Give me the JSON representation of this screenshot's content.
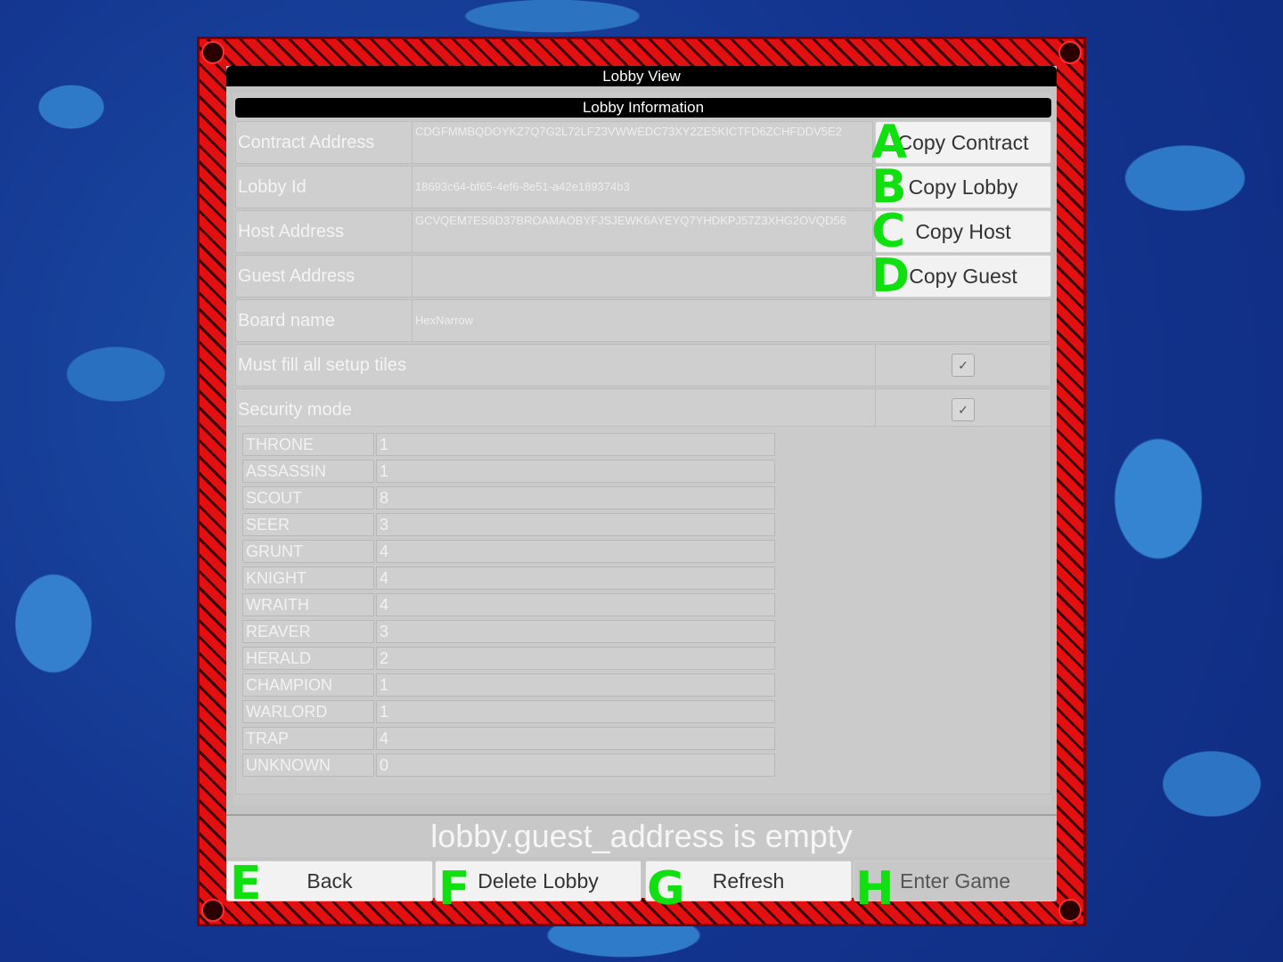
{
  "window": {
    "title": "Lobby View"
  },
  "panel": {
    "title": "Lobby Information"
  },
  "fields": {
    "contract": {
      "label": "Contract Address",
      "value": "CDGFMMBQDOYKZ7Q7G2L72LFZ3VWWEDC73XY2ZE5KICTFD6ZCHFDDV5E2",
      "button": "Copy Contract",
      "hint": "A"
    },
    "lobby": {
      "label": "Lobby Id",
      "value": "18693c64-bf65-4ef6-8e51-a42e189374b3",
      "button": "Copy Lobby",
      "hint": "B"
    },
    "host": {
      "label": "Host Address",
      "value": "GCVQEM7ES6D37BROAMAOBYFJSJEWK6AYEYQ7YHDKPJ57Z3XHG2OVQD56",
      "button": "Copy Host",
      "hint": "C"
    },
    "guest": {
      "label": "Guest Address",
      "value": "",
      "button": "Copy Guest",
      "hint": "D"
    },
    "board": {
      "label": "Board name",
      "value": "HexNarrow"
    },
    "must_fill": {
      "label": "Must fill all setup tiles",
      "checked": true,
      "mark": "✓"
    },
    "security": {
      "label": "Security mode",
      "checked": true,
      "mark": "✓"
    }
  },
  "pieces": [
    {
      "name": "THRONE",
      "count": "1"
    },
    {
      "name": "ASSASSIN",
      "count": "1"
    },
    {
      "name": "SCOUT",
      "count": "8"
    },
    {
      "name": "SEER",
      "count": "3"
    },
    {
      "name": "GRUNT",
      "count": "4"
    },
    {
      "name": "KNIGHT",
      "count": "4"
    },
    {
      "name": "WRAITH",
      "count": "4"
    },
    {
      "name": "REAVER",
      "count": "3"
    },
    {
      "name": "HERALD",
      "count": "2"
    },
    {
      "name": "CHAMPION",
      "count": "1"
    },
    {
      "name": "WARLORD",
      "count": "1"
    },
    {
      "name": "TRAP",
      "count": "4"
    },
    {
      "name": "UNKNOWN",
      "count": "0"
    }
  ],
  "status": {
    "message": "lobby.guest_address is empty"
  },
  "actions": {
    "back": {
      "label": "Back",
      "hint": "E"
    },
    "delete": {
      "label": "Delete Lobby",
      "hint": "F"
    },
    "refresh": {
      "label": "Refresh",
      "hint": "G"
    },
    "enter": {
      "label": "Enter Game",
      "hint": "H",
      "enabled": false
    }
  },
  "colors": {
    "frame": "#e21010",
    "hint": "#10e010",
    "panel": "#c8c8c8"
  }
}
